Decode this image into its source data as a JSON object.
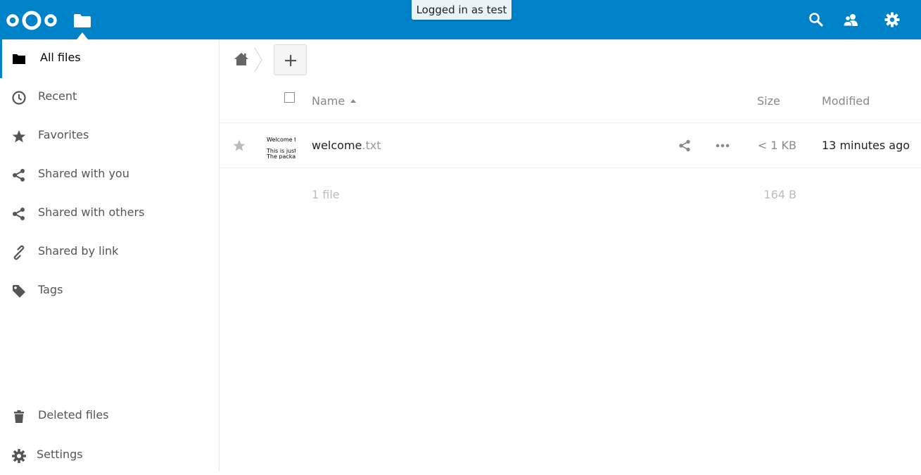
{
  "header": {
    "notice": "Logged in as test",
    "brand_color": "#0082c9",
    "icons": [
      "nextcloud-logo",
      "files-app-icon",
      "search-icon",
      "contacts-icon",
      "settings-gear-icon"
    ]
  },
  "sidebar": {
    "items": [
      {
        "label": "All files",
        "icon": "folder-icon",
        "active": true
      },
      {
        "label": "Recent",
        "icon": "clock-icon"
      },
      {
        "label": "Favorites",
        "icon": "star-icon"
      },
      {
        "label": "Shared with you",
        "icon": "share-icon"
      },
      {
        "label": "Shared with others",
        "icon": "share-icon"
      },
      {
        "label": "Shared by link",
        "icon": "link-icon"
      },
      {
        "label": "Tags",
        "icon": "tag-icon"
      }
    ],
    "footer": [
      {
        "label": "Deleted files",
        "icon": "trash-icon"
      },
      {
        "label": "Settings",
        "icon": "gear-icon"
      }
    ]
  },
  "table": {
    "columns": {
      "name": "Name",
      "size": "Size",
      "modified": "Modified"
    },
    "rows": [
      {
        "basename": "welcome",
        "extension": ".txt",
        "size": "< 1 KB",
        "modified": "13 minutes ago",
        "thumbnail_lines": [
          "Welcome t",
          "This is just",
          "The packa;"
        ]
      }
    ],
    "summary": {
      "files": "1 file",
      "size": "164 B"
    }
  }
}
